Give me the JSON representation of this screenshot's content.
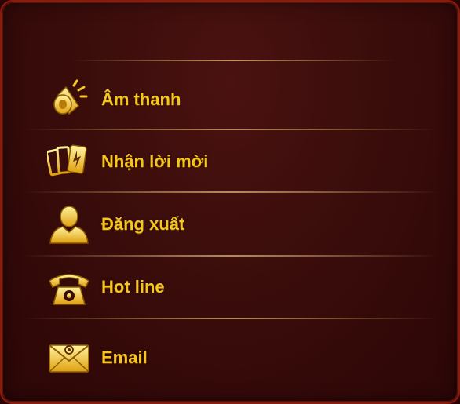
{
  "menu": {
    "items": [
      {
        "label": "Âm thanh",
        "icon": "speaker-icon"
      },
      {
        "label": "Nhận lời mời",
        "icon": "cards-icon"
      },
      {
        "label": "Đăng xuất",
        "icon": "user-icon"
      },
      {
        "label": "Hot line",
        "icon": "phone-icon"
      },
      {
        "label": "Email",
        "icon": "envelope-icon"
      }
    ]
  },
  "colors": {
    "label": "#f6c51e",
    "panel_border": "#8a1c0e",
    "panel_background": "#3a0d0b"
  }
}
